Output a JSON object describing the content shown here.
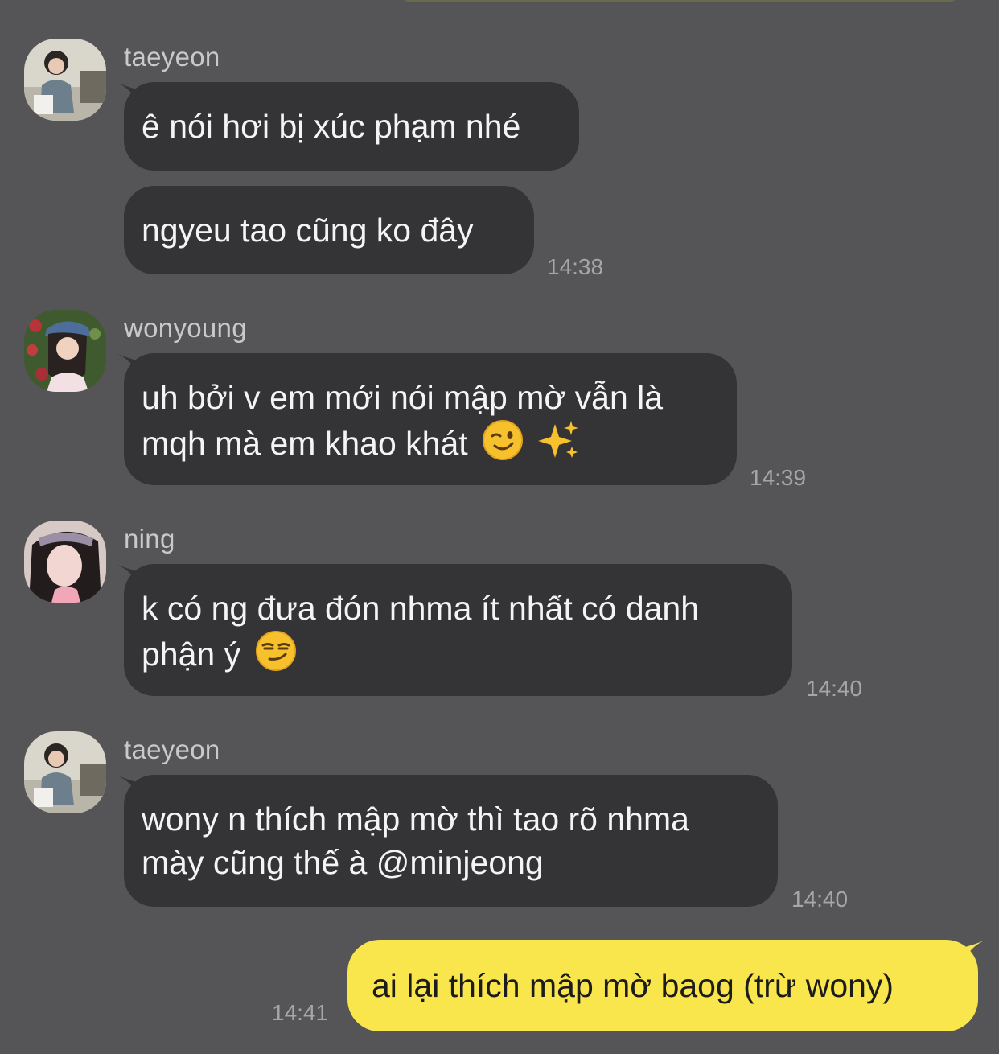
{
  "messages": [
    {
      "sender": "taeyeon",
      "avatar": "taeyeon-avatar",
      "bubbles": [
        "ê nói hơi bị xúc phạm nhé",
        "ngyeu tao cũng ko đây"
      ],
      "time": "14:38"
    },
    {
      "sender": "wonyoung",
      "avatar": "wonyoung-avatar",
      "lines": [
        "uh bởi v em mới nói mập mờ vẫn là",
        "mqh mà em khao khát"
      ],
      "emojis": [
        "winking-face",
        "sparkles"
      ],
      "time": "14:39"
    },
    {
      "sender": "ning",
      "avatar": "ning-avatar",
      "lines": [
        "k có ng đưa đón nhma ít nhất có danh",
        "phận ý"
      ],
      "emojis": [
        "smirking-face"
      ],
      "time": "14:40"
    },
    {
      "sender": "taeyeon",
      "avatar": "taeyeon-avatar",
      "lines": [
        "wony n thích mập mờ thì tao rõ nhma",
        "mày cũng thế à @minjeong"
      ],
      "time": "14:40"
    }
  ],
  "my_message": {
    "text": "ai lại thích mập mờ baog (trừ wony)",
    "time": "14:41"
  },
  "colors": {
    "background": "#555456",
    "incoming_bubble": "#343336",
    "outgoing_bubble": "#f9e54c",
    "sender_text": "#c9c8cb",
    "time_text": "#a6a5a8"
  }
}
